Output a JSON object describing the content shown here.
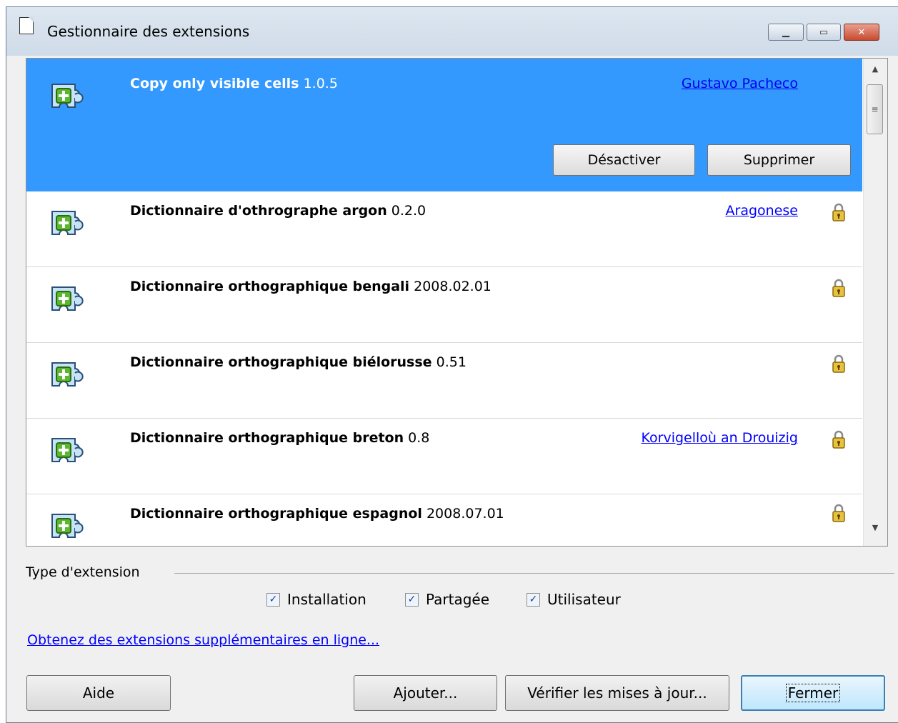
{
  "window": {
    "title": "Gestionnaire des extensions",
    "controls": {
      "minimize": "▁",
      "maximize": "▭",
      "close": "✕"
    }
  },
  "extensions": [
    {
      "name": "Copy only visible cells",
      "version": "1.0.5",
      "author": "Gustavo Pacheco",
      "locked": false,
      "selected": true
    },
    {
      "name": "Dictionnaire d'othrographe argon",
      "version": "0.2.0",
      "author": "Aragonese",
      "locked": true,
      "selected": false
    },
    {
      "name": "Dictionnaire orthographique bengali",
      "version": "2008.02.01",
      "author": "",
      "locked": true,
      "selected": false
    },
    {
      "name": "Dictionnaire orthographique biélorusse",
      "version": "0.51",
      "author": "",
      "locked": true,
      "selected": false
    },
    {
      "name": "Dictionnaire orthographique breton",
      "version": "0.8",
      "author": "Korvigelloù an Drouizig",
      "locked": true,
      "selected": false
    },
    {
      "name": "Dictionnaire orthographique espagnol",
      "version": "2008.07.01",
      "author": "",
      "locked": true,
      "selected": false
    }
  ],
  "selected_actions": {
    "disable": "Désactiver",
    "remove": "Supprimer"
  },
  "filter": {
    "label": "Type d'extension",
    "options": [
      {
        "label": "Installation",
        "checked": true
      },
      {
        "label": "Partagée",
        "checked": true
      },
      {
        "label": "Utilisateur",
        "checked": true
      }
    ]
  },
  "online_link": "Obtenez des extensions supplémentaires en ligne...",
  "buttons": {
    "help": "Aide",
    "add": "Ajouter...",
    "check_updates": "Vérifier les mises à jour...",
    "close": "Fermer"
  },
  "icons": {
    "extension": "puzzle-piece-icon",
    "lock": "lock-icon",
    "check": "✓"
  },
  "colors": {
    "selection": "#3399ff",
    "link": "#0000ff",
    "puzzle_fill": "#c7e4f6",
    "puzzle_plus": "#5bb72f"
  }
}
